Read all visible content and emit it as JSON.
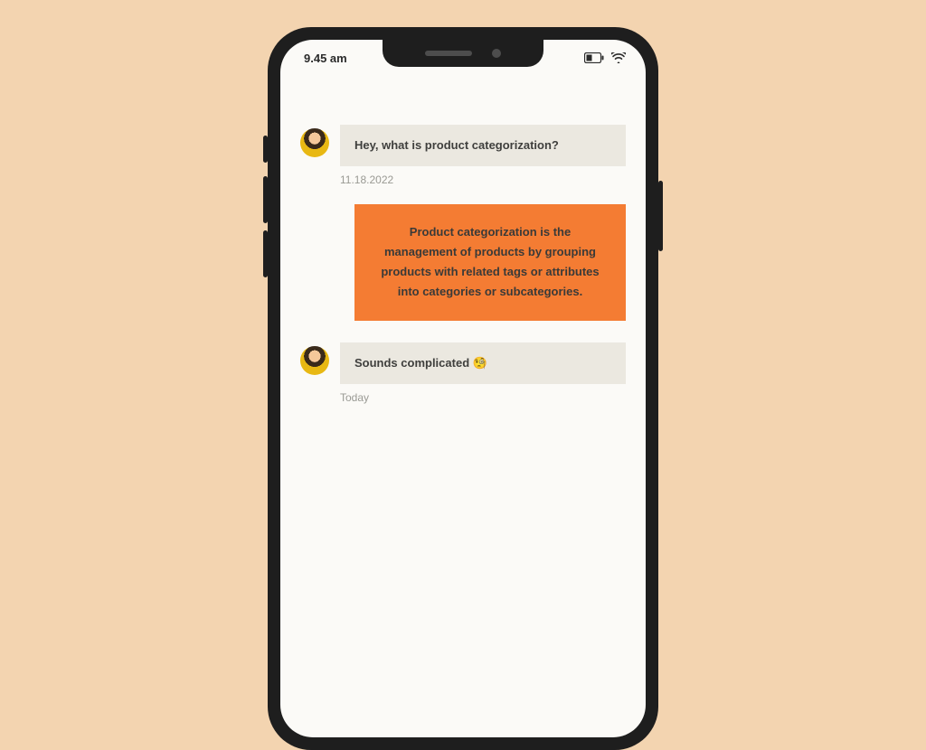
{
  "status": {
    "time": "9.45 am"
  },
  "messages": {
    "m1": {
      "text": "Hey, what is product categorization?",
      "timestamp": "11.18.2022"
    },
    "reply1": {
      "text": "Product categorization is the management of products by grouping products with related tags or attributes into categories or subcategories."
    },
    "m2": {
      "text": "Sounds complicated 🧐",
      "timestamp": "Today"
    }
  }
}
